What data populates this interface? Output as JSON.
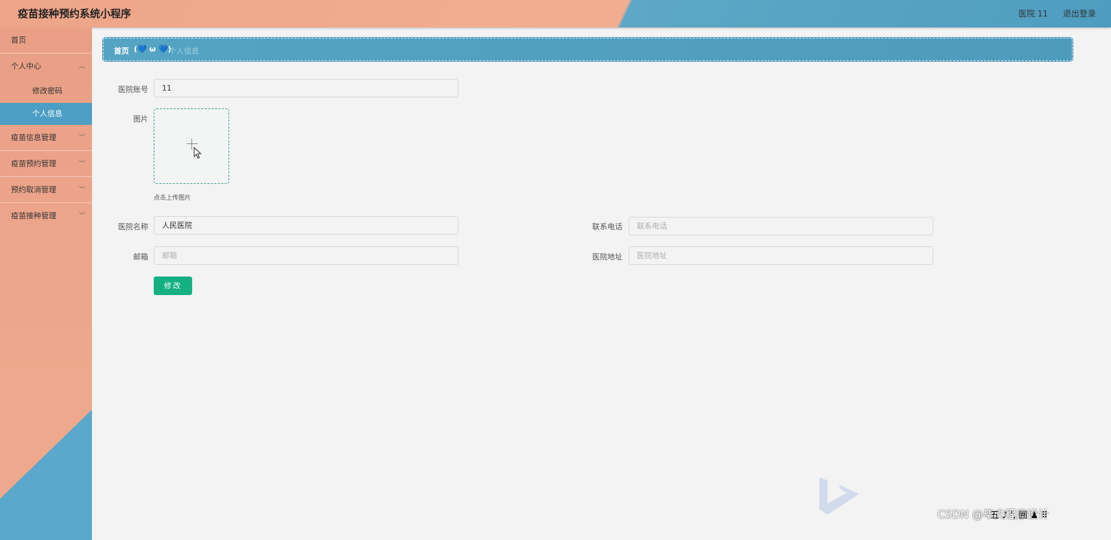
{
  "header": {
    "app_title": "疫苗接种预约系统小程序",
    "user_label": "医院 11",
    "logout_label": "退出登录"
  },
  "sidebar": {
    "items": [
      {
        "label": "首页"
      },
      {
        "label": "个人中心",
        "children": [
          {
            "label": "修改密码"
          },
          {
            "label": "个人信息",
            "active": true
          }
        ]
      },
      {
        "label": "疫苗信息管理"
      },
      {
        "label": "疫苗预约管理"
      },
      {
        "label": "预约取消管理"
      },
      {
        "label": "疫苗接种管理"
      }
    ]
  },
  "breadcrumb": {
    "home": "首页",
    "emoji": "(💙 ω 💙)",
    "current": "个人信息"
  },
  "form": {
    "account_label": "医院账号",
    "account_value": "11",
    "image_label": "图片",
    "upload_tip": "点击上传图片",
    "name_label": "医院名称",
    "name_value": "人民医院",
    "phone_label": "联系电话",
    "phone_placeholder": "联系电话",
    "email_label": "邮箱",
    "email_placeholder": "邮箱",
    "address_label": "医院地址",
    "address_placeholder": "医院地址",
    "submit_label": "修改"
  },
  "watermark": "CSDN @毕文程序设计",
  "ime_text": "五 ♪ ', 囲 ♟ ⠿",
  "colors": {
    "accent": "#4d9ec4",
    "sidebar": "#eda88d",
    "submit": "#14b082"
  }
}
